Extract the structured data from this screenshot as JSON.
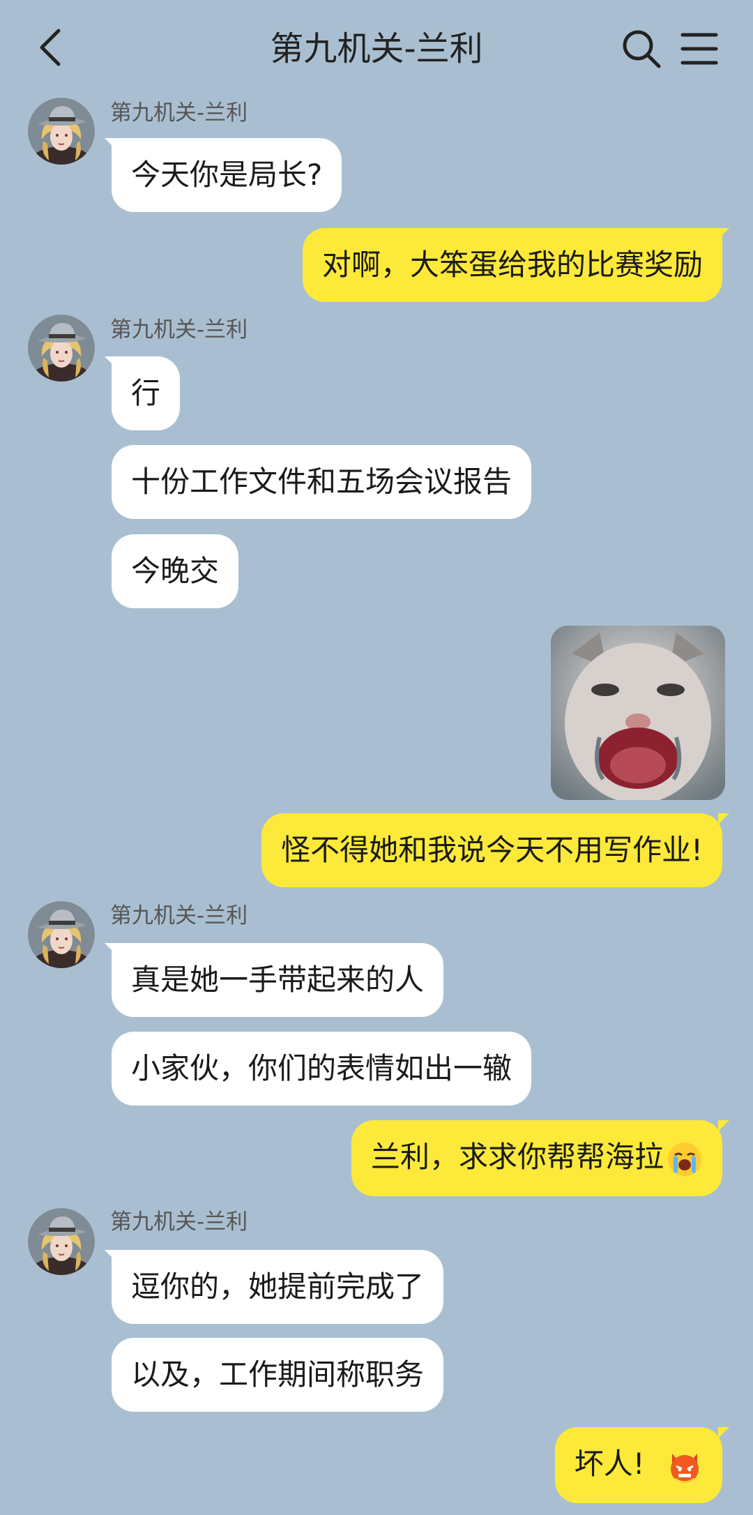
{
  "header": {
    "title": "第九机关-兰利",
    "back_icon": "chevron-left-icon",
    "search_icon": "search-icon",
    "menu_icon": "hamburger-menu-icon"
  },
  "colors": {
    "background": "#a9bfd1",
    "incoming_bubble": "#ffffff",
    "outgoing_bubble": "#fce93a"
  },
  "messages": [
    {
      "sender": "第九机关-兰利",
      "text": "今天你是局长?"
    },
    {
      "text": "对啊，大笨蛋给我的比赛奖励"
    },
    {
      "sender": "第九机关-兰利",
      "text": "行"
    },
    {
      "text": "十份工作文件和五场会议报告"
    },
    {
      "text": "今晚交"
    },
    {
      "sticker": "crying-cat-sticker"
    },
    {
      "text": "怪不得她和我说今天不用写作业!"
    },
    {
      "sender": "第九机关-兰利",
      "text": "真是她一手带起来的人"
    },
    {
      "text": "小家伙，你们的表情如出一辙"
    },
    {
      "text": "兰利，求求你帮帮海拉",
      "emoji": "loudly-crying-emoji"
    },
    {
      "sender": "第九机关-兰利",
      "text": "逗你的，她提前完成了"
    },
    {
      "text": "以及，工作期间称职务"
    },
    {
      "text": "坏人!",
      "emoji": "angry-devil-emoji"
    }
  ]
}
